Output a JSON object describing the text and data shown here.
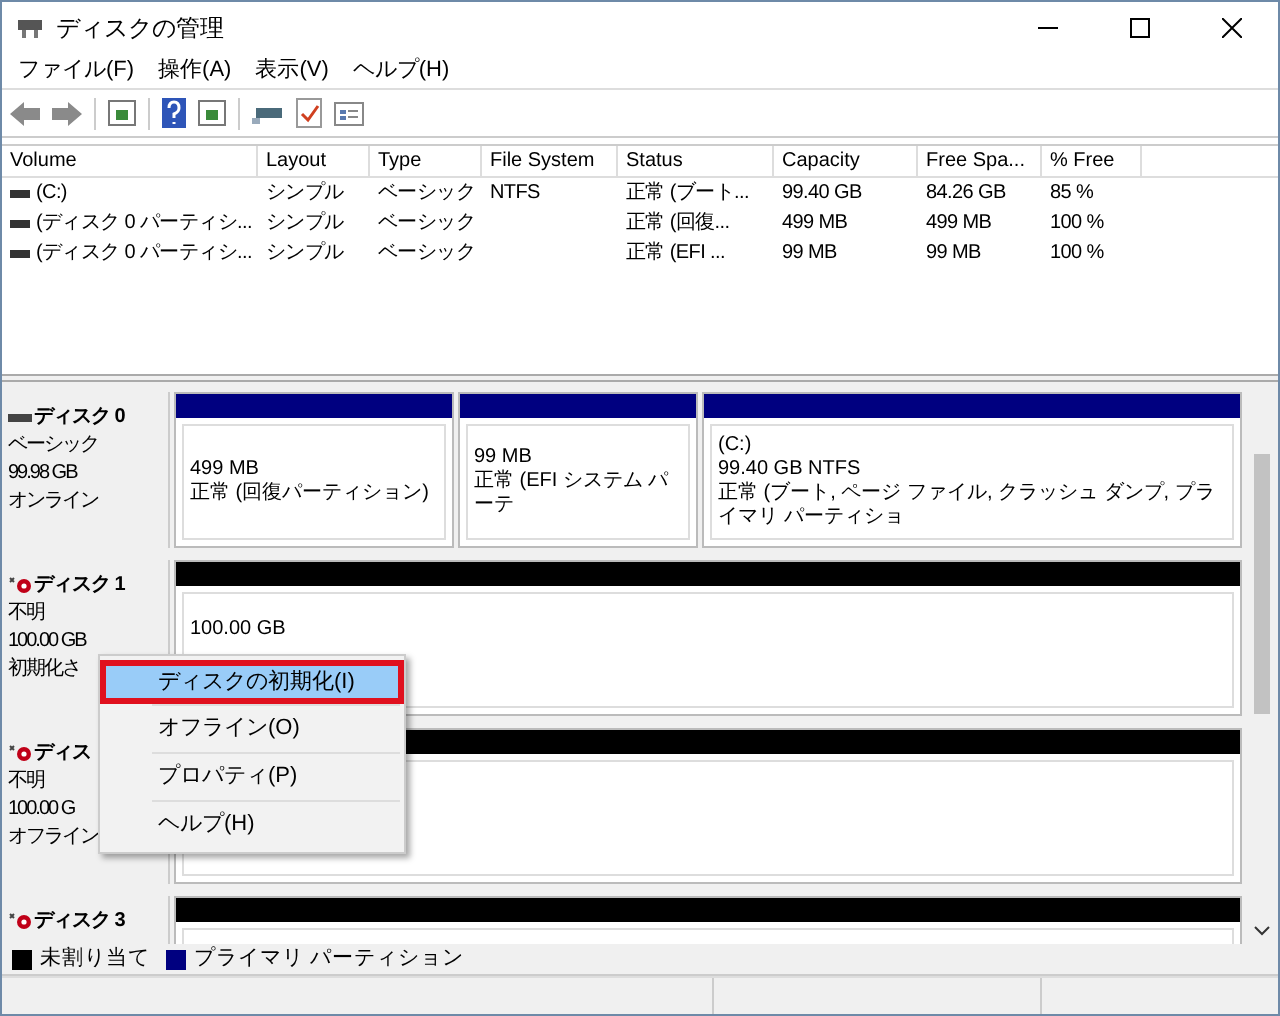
{
  "window": {
    "title": "ディスクの管理"
  },
  "menu": [
    "ファイル(F)",
    "操作(A)",
    "表示(V)",
    "ヘルプ(H)"
  ],
  "volume_table": {
    "columns": [
      "Volume",
      "Layout",
      "Type",
      "File System",
      "Status",
      "Capacity",
      "Free Spa...",
      "% Free"
    ],
    "rows": [
      [
        "(C:)",
        "シンプル",
        "ベーシック",
        "NTFS",
        "正常 (ブート...",
        "99.40 GB",
        "84.26 GB",
        "85 %"
      ],
      [
        "(ディスク 0 パーティシ...",
        "シンプル",
        "ベーシック",
        "",
        "正常 (回復...",
        "499 MB",
        "499 MB",
        "100 %"
      ],
      [
        "(ディスク 0 パーティシ...",
        "シンプル",
        "ベーシック",
        "",
        "正常 (EFI ...",
        "99 MB",
        "99 MB",
        "100 %"
      ]
    ]
  },
  "disks": [
    {
      "kind": "online",
      "name": "ディスク 0",
      "lines": [
        "ベーシック",
        "99.98 GB",
        "オンライン"
      ],
      "partitions": [
        {
          "kind": "primary",
          "lines": [
            "499 MB",
            "正常 (回復パーティション)"
          ]
        },
        {
          "kind": "primary",
          "lines": [
            "99 MB",
            "正常 (EFI システム パーテ"
          ]
        },
        {
          "kind": "primary",
          "lines": [
            "(C:)",
            "99.40 GB NTFS",
            "正常 (ブート, ページ ファイル, クラッシュ ダンプ, プライマリ パーティショ"
          ]
        }
      ]
    },
    {
      "kind": "unknown",
      "name": "ディスク 1",
      "lines": [
        "不明",
        "100.00 GB",
        "初期化さ"
      ],
      "partitions": [
        {
          "kind": "unallocated",
          "lines": [
            "100.00 GB"
          ]
        }
      ]
    },
    {
      "kind": "unknown",
      "name": "ディス",
      "lines": [
        "不明",
        "100.00 G",
        "オフライン"
      ],
      "partitions": [
        {
          "kind": "unallocated"
        }
      ]
    },
    {
      "kind": "unknown",
      "name": "ディスク 3",
      "partitions": [
        {
          "kind": "unallocated"
        }
      ]
    }
  ],
  "legend": [
    {
      "label": "未割り当て",
      "color": "#000000"
    },
    {
      "label": "プライマリ パーティション",
      "color": "#000080"
    }
  ],
  "context_menu": [
    {
      "label": "ディスクの初期化(I)",
      "selected": true
    },
    {
      "label": "オフライン(O)",
      "selected": false
    },
    {
      "label": "プロパティ(P)",
      "selected": false
    },
    {
      "label": "ヘルプ(H)",
      "selected": false
    }
  ]
}
